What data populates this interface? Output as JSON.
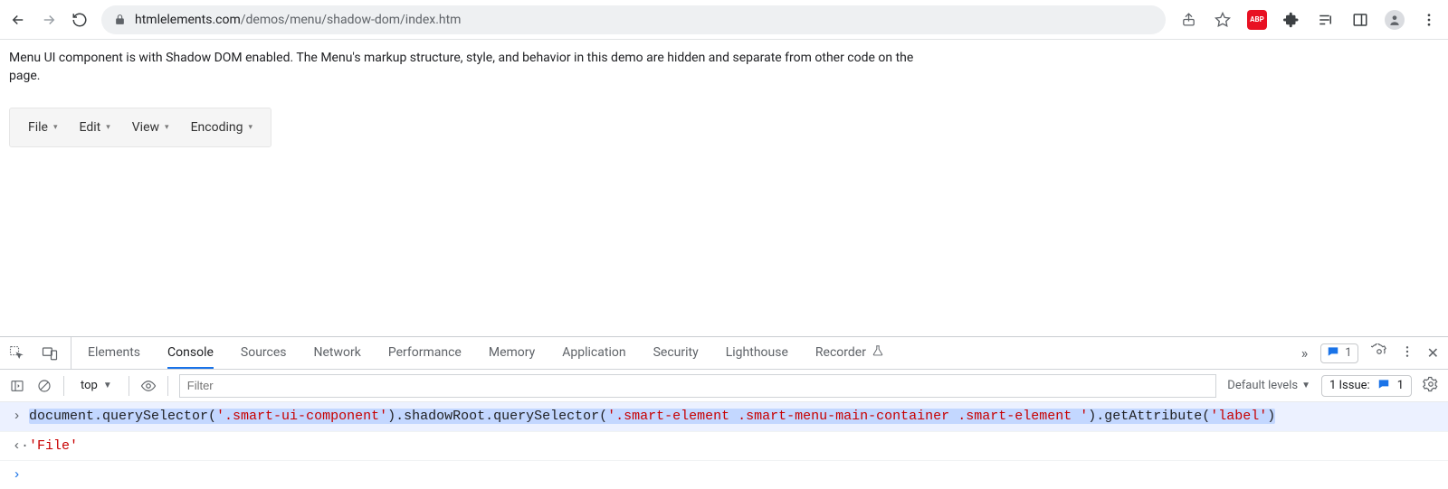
{
  "browser": {
    "url_domain": "htmlelements.com",
    "url_path": "/demos/menu/shadow-dom/index.htm",
    "abp_label": "ABP"
  },
  "page": {
    "description": "Menu UI component is with Shadow DOM enabled. The Menu's markup structure, style, and behavior in this demo are hidden and separate from other code on the page.",
    "menu": {
      "items": [
        {
          "label": "File"
        },
        {
          "label": "Edit"
        },
        {
          "label": "View"
        },
        {
          "label": "Encoding"
        }
      ]
    }
  },
  "devtools": {
    "tabs": [
      {
        "label": "Elements"
      },
      {
        "label": "Console",
        "active": true
      },
      {
        "label": "Sources"
      },
      {
        "label": "Network"
      },
      {
        "label": "Performance"
      },
      {
        "label": "Memory"
      },
      {
        "label": "Application"
      },
      {
        "label": "Security"
      },
      {
        "label": "Lighthouse"
      },
      {
        "label": "Recorder",
        "experimental": true
      }
    ],
    "message_count": "1",
    "subbar": {
      "context": "top",
      "filter_placeholder": "Filter",
      "level_label": "Default levels",
      "issue_label": "1 Issue:",
      "issue_count": "1"
    },
    "console": {
      "input_tokens": {
        "p1": "document",
        "p2": ".querySelector(",
        "p3": "'.smart-ui-component'",
        "p4": ").shadowRoot.querySelector(",
        "p5": "'.smart-element .smart-menu-main-container .smart-element '",
        "p6": ").getAttribute(",
        "p7": "'label'",
        "p8": ")"
      },
      "result": "'File'"
    }
  }
}
